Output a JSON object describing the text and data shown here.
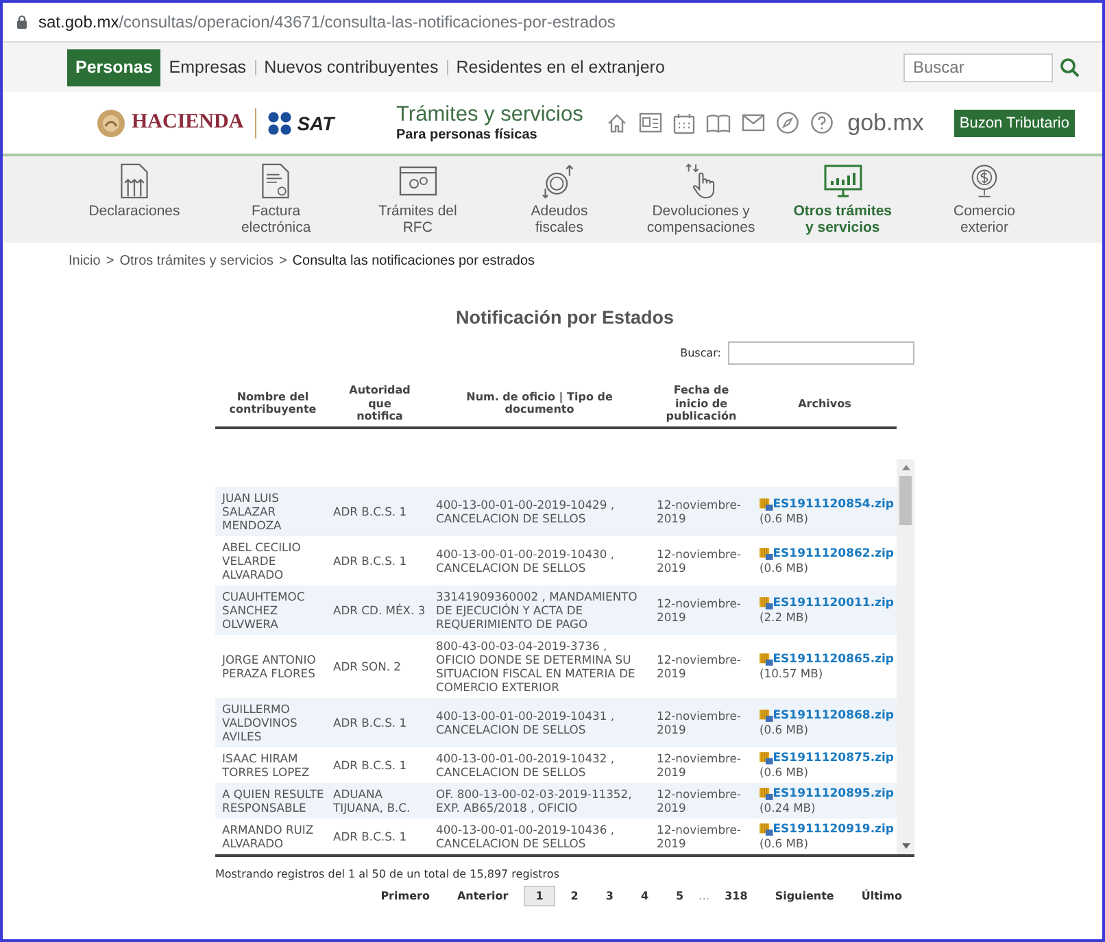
{
  "url": {
    "domain": "sat.gob.mx",
    "path": "/consultas/operacion/43671/consulta-las-notificaciones-por-estrados"
  },
  "top_nav": {
    "items": [
      {
        "label": "Personas",
        "selected": true
      },
      {
        "label": "Empresas",
        "selected": false
      },
      {
        "label": "Nuevos contribuyentes",
        "selected": false
      },
      {
        "label": "Residentes en el extranjero",
        "selected": false
      }
    ],
    "search": {
      "placeholder": "Buscar"
    }
  },
  "header": {
    "hacienda": "HACIENDA",
    "sat": "SAT",
    "title": "Trámites y servicios",
    "subtitle": "Para personas físicas",
    "gob": "gob.mx",
    "button": "Buzon Tributario"
  },
  "menu": [
    {
      "label": "Declaraciones",
      "selected": false
    },
    {
      "label": "Factura\nelectrónica",
      "selected": false
    },
    {
      "label": "Trámites del\nRFC",
      "selected": false
    },
    {
      "label": "Adeudos\nfiscales",
      "selected": false
    },
    {
      "label": "Devoluciones y\ncompensaciones",
      "selected": false
    },
    {
      "label": "Otros trámites\ny servicios",
      "selected": true
    },
    {
      "label": "Comercio\nexterior",
      "selected": false
    }
  ],
  "breadcrumb": {
    "separator": ">",
    "items": [
      {
        "label": "Inicio",
        "kind": "link"
      },
      {
        "label": "Otros trámites y servicios",
        "kind": "link"
      },
      {
        "label": "Consulta las notificaciones por estrados",
        "kind": "current"
      }
    ]
  },
  "title": "Notificación por Estados",
  "table_search": {
    "label": "Buscar:"
  },
  "table": {
    "columns": [
      "Nombre del\ncontribuyente",
      "Autoridad\nque\nnotifica",
      "Num. de oficio | Tipo de\ndocumento",
      "Fecha de\ninicio de\npublicación",
      "Archivos"
    ],
    "rows": [
      {
        "name": "JUAN LUIS SALAZAR MENDOZA",
        "authority": "ADR B.C.S. 1",
        "document": "400-13-00-01-00-2019-10429 , CANCELACION DE SELLOS",
        "date": "12-noviembre-2019",
        "file": "ES1911120854.zip",
        "size": "(0.6 MB)"
      },
      {
        "name": "ABEL CECILIO VELARDE ALVARADO",
        "authority": "ADR B.C.S. 1",
        "document": "400-13-00-01-00-2019-10430 , CANCELACION DE SELLOS",
        "date": "12-noviembre-2019",
        "file": "ES1911120862.zip",
        "size": "(0.6 MB)"
      },
      {
        "name": "CUAUHTEMOC SANCHEZ OLVWERA",
        "authority": "ADR CD. MÉX. 3",
        "document": "33141909360002 , MANDAMIENTO DE EJECUCIÓN Y ACTA DE REQUERIMIENTO DE PAGO",
        "date": "12-noviembre-2019",
        "file": "ES1911120011.zip",
        "size": "(2.2 MB)"
      },
      {
        "name": "JORGE ANTONIO PERAZA FLORES",
        "authority": "ADR SON. 2",
        "document": "800-43-00-03-04-2019-3736 , OFICIO DONDE SE DETERMINA SU SITUACION FISCAL EN MATERIA DE COMERCIO EXTERIOR",
        "date": "12-noviembre-2019",
        "file": "ES1911120865.zip",
        "size": "(10.57 MB)"
      },
      {
        "name": "GUILLERMO VALDOVINOS AVILES",
        "authority": "ADR B.C.S. 1",
        "document": "400-13-00-01-00-2019-10431 , CANCELACION DE SELLOS",
        "date": "12-noviembre-2019",
        "file": "ES1911120868.zip",
        "size": "(0.6 MB)"
      },
      {
        "name": "ISAAC HIRAM TORRES LOPEZ",
        "authority": "ADR B.C.S. 1",
        "document": "400-13-00-01-00-2019-10432 , CANCELACION DE SELLOS",
        "date": "12-noviembre-2019",
        "file": "ES1911120875.zip",
        "size": "(0.6 MB)"
      },
      {
        "name": "A QUIEN RESULTE RESPONSABLE",
        "authority": "ADUANA TIJUANA, B.C.",
        "document": "OF. 800-13-00-02-03-2019-11352, EXP. AB65/2018 , OFICIO",
        "date": "12-noviembre-2019",
        "file": "ES1911120895.zip",
        "size": "(0.24 MB)"
      },
      {
        "name": "ARMANDO RUIZ ALVARADO",
        "authority": "ADR B.C.S. 1",
        "document": "400-13-00-01-00-2019-10436 , CANCELACION DE SELLOS",
        "date": "12-noviembre-2019",
        "file": "ES1911120919.zip",
        "size": "(0.6 MB)"
      }
    ]
  },
  "info": "Mostrando registros del 1 al 50 de un total de 15,897 registros",
  "pagination": [
    {
      "label": "Primero",
      "kind": "nav"
    },
    {
      "label": "Anterior",
      "kind": "nav"
    },
    {
      "label": "1",
      "kind": "page",
      "selected": true
    },
    {
      "label": "2",
      "kind": "page",
      "selected": false
    },
    {
      "label": "3",
      "kind": "page",
      "selected": false
    },
    {
      "label": "4",
      "kind": "page",
      "selected": false
    },
    {
      "label": "5",
      "kind": "page",
      "selected": false
    },
    {
      "label": "…",
      "kind": "gap"
    },
    {
      "label": "318",
      "kind": "page",
      "selected": false
    },
    {
      "label": "Siguiente",
      "kind": "nav"
    },
    {
      "label": "Último",
      "kind": "nav"
    }
  ]
}
